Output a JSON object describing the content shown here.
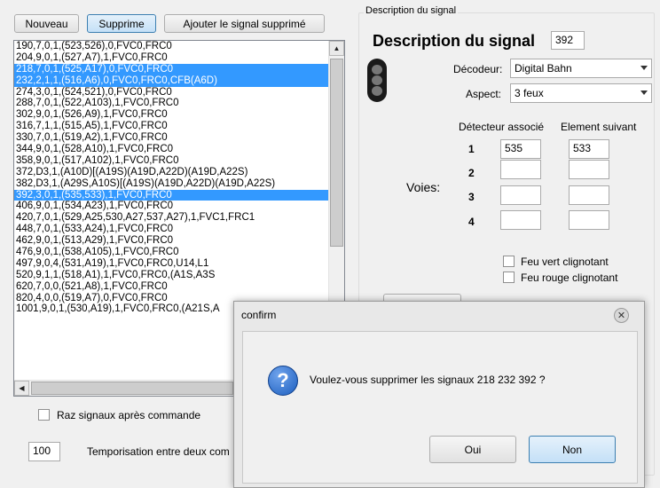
{
  "toolbar": {
    "new_label": "Nouveau",
    "delete_label": "Supprime",
    "restore_label": "Ajouter le signal supprimé"
  },
  "signals": [
    {
      "text": "190,7,0,1,(523,526),0,FVC0,FRC0",
      "selected": false
    },
    {
      "text": "204,9,0,1,(527,A7),1,FVC0,FRC0",
      "selected": false
    },
    {
      "text": "218,7,0,1,(525,A17),0,FVC0,FRC0",
      "selected": true
    },
    {
      "text": "232,2,1,1,(516,A6),0,FVC0,FRC0,CFB(A6D)",
      "selected": true
    },
    {
      "text": "274,3,0,1,(524,521),0,FVC0,FRC0",
      "selected": false
    },
    {
      "text": "288,7,0,1,(522,A103),1,FVC0,FRC0",
      "selected": false
    },
    {
      "text": "302,9,0,1,(526,A9),1,FVC0,FRC0",
      "selected": false
    },
    {
      "text": "316,7,1,1,(515,A5),1,FVC0,FRC0",
      "selected": false
    },
    {
      "text": "330,7,0,1,(519,A2),1,FVC0,FRC0",
      "selected": false
    },
    {
      "text": "344,9,0,1,(528,A10),1,FVC0,FRC0",
      "selected": false
    },
    {
      "text": "358,9,0,1,(517,A102),1,FVC0,FRC0",
      "selected": false
    },
    {
      "text": "372,D3,1,(A10D)[(A19S)(A19D,A22D)(A19D,A22S)",
      "selected": false
    },
    {
      "text": "382,D3,1,(A29S,A10S)[(A19S)(A19D,A22D)(A19D,A22S)",
      "selected": false
    },
    {
      "text": "392,3,0,1,(535,533),1,FVC0,FRC0",
      "selected": true
    },
    {
      "text": "406,9,0,1,(534,A23),1,FVC0,FRC0",
      "selected": false
    },
    {
      "text": "420,7,0,1,(529,A25,530,A27,537,A27),1,FVC1,FRC1",
      "selected": false
    },
    {
      "text": "448,7,0,1,(533,A24),1,FVC0,FRC0",
      "selected": false
    },
    {
      "text": "462,9,0,1,(513,A29),1,FVC0,FRC0",
      "selected": false
    },
    {
      "text": "476,9,0,1,(538,A105),1,FVC0,FRC0",
      "selected": false
    },
    {
      "text": "497,9,0,4,(531,A19),1,FVC0,FRC0,U14,L1",
      "selected": false
    },
    {
      "text": "520,9,1,1,(518,A1),1,FVC0,FRC0,(A1S,A3S",
      "selected": false
    },
    {
      "text": "620,7,0,0,(521,A8),1,FVC0,FRC0",
      "selected": false
    },
    {
      "text": "820,4,0,0,(519,A7),0,FVC0,FRC0",
      "selected": false
    },
    {
      "text": "1001,9,0,1,(530,A19),1,FVC0,FRC0,(A21S,A",
      "selected": false
    }
  ],
  "options": {
    "raz_label": "Raz signaux après commande",
    "tempo_value": "100",
    "tempo_label": "Temporisation entre deux com"
  },
  "description": {
    "group_label": "Description du signal",
    "title": "Description du signal",
    "address": "392",
    "decoder_label": "Décodeur:",
    "decoder_value": "Digital Bahn",
    "aspect_label": "Aspect:",
    "aspect_value": "3 feux",
    "detector_header": "Détecteur associé",
    "next_header": "Element suivant",
    "voies_label": "Voies:",
    "rows": [
      {
        "num": "1",
        "detector": "535",
        "next": "533"
      },
      {
        "num": "2",
        "detector": "",
        "next": ""
      },
      {
        "num": "3",
        "detector": "",
        "next": ""
      },
      {
        "num": "4",
        "detector": "",
        "next": ""
      }
    ],
    "green_blink_label": "Feu vert clignotant",
    "red_blink_label": "Feu rouge clignotant"
  },
  "dialog": {
    "title": "confirm",
    "message": "Voulez-vous supprimer  les signaux 218 232 392  ?",
    "yes_label": "Oui",
    "no_label": "Non",
    "question_icon_glyph": "?"
  },
  "colors": {
    "selection": "#3399ff",
    "accent": "#3c7fb1",
    "question_icon": "#1d5fbf"
  }
}
